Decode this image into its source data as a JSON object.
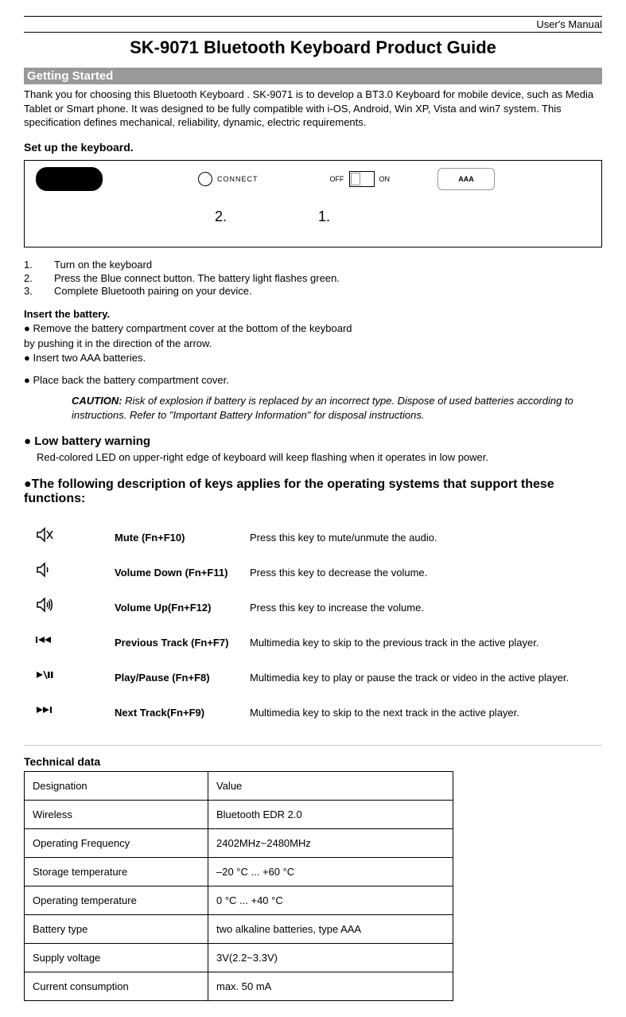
{
  "header_right": "User's Manual",
  "title": "SK-9071 Bluetooth Keyboard Product Guide",
  "section_getting_started": "Getting Started",
  "intro": "Thank you for choosing this Bluetooth Keyboard . SK-9071 is to develop a BT3.0 Keyboard for mobile device, such as Media Tablet or Smart phone. It was designed to be fully compatible with i-OS, Android, Win XP, Vista and win7 system. This specification defines mechanical, reliability, dynamic, electric requirements.",
  "setup_heading": "Set up the keyboard.",
  "diagram": {
    "connect": "CONNECT",
    "off": "OFF",
    "on": "ON",
    "battery": "AAA",
    "label2": "2.",
    "label1": "1."
  },
  "steps": [
    {
      "num": "1.",
      "text": "Turn on the keyboard"
    },
    {
      "num": "2.",
      "text": "Press the Blue connect button. The battery light flashes green."
    },
    {
      "num": "3.",
      "text": "Complete Bluetooth pairing on your device."
    }
  ],
  "insert_heading": "Insert the battery.",
  "insert_items": [
    "● Remove the battery compartment cover at the bottom of the keyboard",
    "by pushing it in the direction of the arrow.",
    "● Insert two AAA batteries.",
    "",
    "● Place back the battery compartment cover."
  ],
  "caution_label": "CAUTION:",
  "caution_text": " Risk of explosion if battery is replaced by an incorrect type. Dispose of used batteries according to instructions. Refer to \"Important Battery Information\" for disposal instructions.",
  "lowbat_heading": "● Low battery warning",
  "lowbat_desc": "Red-colored LED on upper-right edge of keyboard will keep flashing when it operates in low power.",
  "keys_heading": "●The following description of keys applies for the operating systems that support these functions:",
  "keys": [
    {
      "icon": "mute-icon",
      "name": "Mute (Fn+F10)",
      "desc": "Press this key to mute/unmute the audio."
    },
    {
      "icon": "vol-down-icon",
      "name": "Volume Down (Fn+F11)",
      "desc": "Press this key to decrease the volume."
    },
    {
      "icon": "vol-up-icon",
      "name": "Volume Up(Fn+F12)",
      "desc": "Press this key to increase the volume."
    },
    {
      "icon": "prev-track-icon",
      "name": "Previous Track (Fn+F7)",
      "desc": "Multimedia key to skip to the previous track in the active player."
    },
    {
      "icon": "play-pause-icon",
      "name": "Play/Pause (Fn+F8)",
      "desc": "Multimedia key to play or pause the track or video in the active player."
    },
    {
      "icon": "next-track-icon",
      "name": "Next Track(Fn+F9)",
      "desc": "Multimedia key to skip to the next track in the active player."
    }
  ],
  "tech_heading": "Technical data",
  "tech_table": [
    {
      "d": "Designation",
      "v": "Value"
    },
    {
      "d": "Wireless",
      "v": "Bluetooth EDR 2.0"
    },
    {
      "d": "Operating Frequency",
      "v": "2402MHz~2480MHz"
    },
    {
      "d": "Storage temperature",
      "v": "–20 °C ... +60 °C"
    },
    {
      "d": "Operating temperature",
      "v": "0 °C ... +40 °C"
    },
    {
      "d": "Battery type",
      "v": "two alkaline batteries, type AAA"
    },
    {
      "d": "Supply voltage",
      "v": "3V(2.2~3.3V)"
    },
    {
      "d": "Current consumption",
      "v": "max. 50 mA"
    }
  ]
}
